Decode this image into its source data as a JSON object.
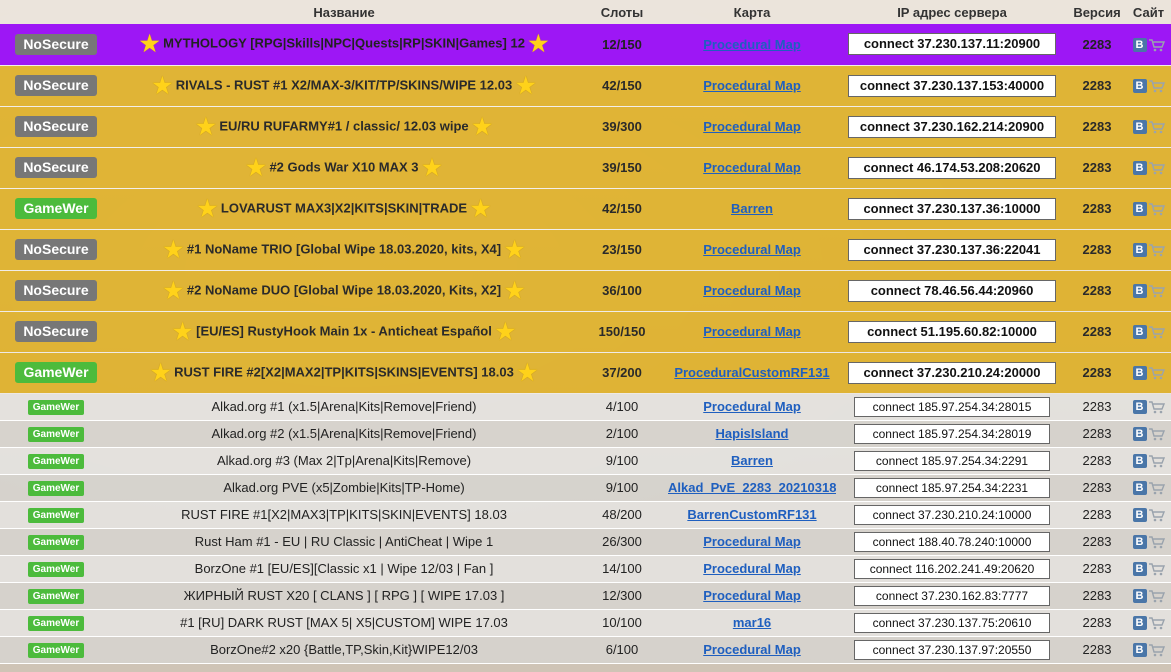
{
  "headers": {
    "name": "Название",
    "slots": "Слоты",
    "map": "Карта",
    "ip": "IP адрес сервера",
    "version": "Версия",
    "site": "Сайт"
  },
  "premium": [
    {
      "badge": "NoSecure",
      "name": "MYTHOLOGY [RPG|Skills|NPC|Quests|RP|SKIN|Games] 12",
      "slots": "12/150",
      "map": "Procedural Map",
      "ip": "connect 37.230.137.11:20900",
      "version": "2283"
    },
    {
      "badge": "NoSecure",
      "name": "RIVALS - RUST #1 X2/MAX-3/KIT/TP/SKINS/WIPE 12.03",
      "slots": "42/150",
      "map": "Procedural Map",
      "ip": "connect 37.230.137.153:40000",
      "version": "2283"
    },
    {
      "badge": "NoSecure",
      "name": "EU/RU RUFARMY#1 / classic/ 12.03 wipe",
      "slots": "39/300",
      "map": "Procedural Map",
      "ip": "connect 37.230.162.214:20900",
      "version": "2283"
    },
    {
      "badge": "NoSecure",
      "name": "#2 Gods War X10 MAX 3",
      "slots": "39/150",
      "map": "Procedural Map",
      "ip": "connect 46.174.53.208:20620",
      "version": "2283"
    },
    {
      "badge": "GameWer",
      "name": "LOVARUST MAX3|X2|KITS|SKIN|TRADE",
      "slots": "42/150",
      "map": "Barren",
      "ip": "connect 37.230.137.36:10000",
      "version": "2283"
    },
    {
      "badge": "NoSecure",
      "name": "#1 NoName TRIO [Global Wipe 18.03.2020, kits, X4]",
      "slots": "23/150",
      "map": "Procedural Map",
      "ip": "connect 37.230.137.36:22041",
      "version": "2283"
    },
    {
      "badge": "NoSecure",
      "name": "#2 NoName DUO [Global Wipe 18.03.2020, Kits, X2]",
      "slots": "36/100",
      "map": "Procedural Map",
      "ip": "connect 78.46.56.44:20960",
      "version": "2283"
    },
    {
      "badge": "NoSecure",
      "name": "[EU/ES] RustyHook Main 1x - Anticheat Español",
      "slots": "150/150",
      "map": "Procedural Map",
      "ip": "connect 51.195.60.82:10000",
      "version": "2283"
    },
    {
      "badge": "GameWer",
      "name": "RUST FIRE #2[X2|MAX2|TP|KITS|SKINS|EVENTS] 18.03",
      "slots": "37/200",
      "map": "ProceduralCustomRF131",
      "ip": "connect 37.230.210.24:20000",
      "version": "2283"
    }
  ],
  "regular": [
    {
      "badge": "GameWer",
      "name": "Alkad.org #1 (x1.5|Arena|Kits|Remove|Friend)",
      "slots": "4/100",
      "map": "Procedural Map",
      "ip": "connect 185.97.254.34:28015",
      "version": "2283"
    },
    {
      "badge": "GameWer",
      "name": "Alkad.org #2 (x1.5|Arena|Kits|Remove|Friend)",
      "slots": "2/100",
      "map": "HapisIsland",
      "ip": "connect 185.97.254.34:28019",
      "version": "2283"
    },
    {
      "badge": "GameWer",
      "name": "Alkad.org #3 (Max 2|Tp|Arena|Kits|Remove)",
      "slots": "9/100",
      "map": "Barren",
      "ip": "connect 185.97.254.34:2291",
      "version": "2283"
    },
    {
      "badge": "GameWer",
      "name": "Alkad.org PVE (x5|Zombie|Kits|TP-Home)",
      "slots": "9/100",
      "map": "Alkad_PvE_2283_20210318",
      "ip": "connect 185.97.254.34:2231",
      "version": "2283"
    },
    {
      "badge": "GameWer",
      "name": "RUST FIRE #1[X2|MAX3|TP|KITS|SKIN|EVENTS] 18.03",
      "slots": "48/200",
      "map": "BarrenCustomRF131",
      "ip": "connect 37.230.210.24:10000",
      "version": "2283"
    },
    {
      "badge": "GameWer",
      "name": "Rust Ham #1 - EU | RU Classic | AntiCheat | Wipe 1",
      "slots": "26/300",
      "map": "Procedural Map",
      "ip": "connect 188.40.78.240:10000",
      "version": "2283"
    },
    {
      "badge": "GameWer",
      "name": "BorzOne #1 [EU/ES][Classic x1 | Wipe 12/03 | Fan ]",
      "slots": "14/100",
      "map": "Procedural Map",
      "ip": "connect 116.202.241.49:20620",
      "version": "2283"
    },
    {
      "badge": "GameWer",
      "name": "ЖИРНЫЙ RUST X20 [ CLANS ] [ RPG ] [ WIPE 17.03 ]",
      "slots": "12/300",
      "map": "Procedural Map",
      "ip": "connect 37.230.162.83:7777",
      "version": "2283"
    },
    {
      "badge": "GameWer",
      "name": "#1 [RU] DARK RUST [MAX 5| X5|CUSTOM] WIPE 17.03",
      "slots": "10/100",
      "map": "mar16",
      "ip": "connect 37.230.137.75:20610",
      "version": "2283"
    },
    {
      "badge": "GameWer",
      "name": "BorzOne#2 x20 {Battle,TP,Skin,Kit}WIPE12/03",
      "slots": "6/100",
      "map": "Procedural Map",
      "ip": "connect 37.230.137.97:20550",
      "version": "2283"
    }
  ],
  "icons": {
    "star": "star-icon",
    "vk": "vk-icon",
    "cart": "cart-icon"
  },
  "vk_label": "B",
  "colors": {
    "premium": "#deb028",
    "highlight": "#9d17f5",
    "nosecure": "#777777",
    "gamewer": "#4cbb3c",
    "link": "#1f5fbf"
  }
}
